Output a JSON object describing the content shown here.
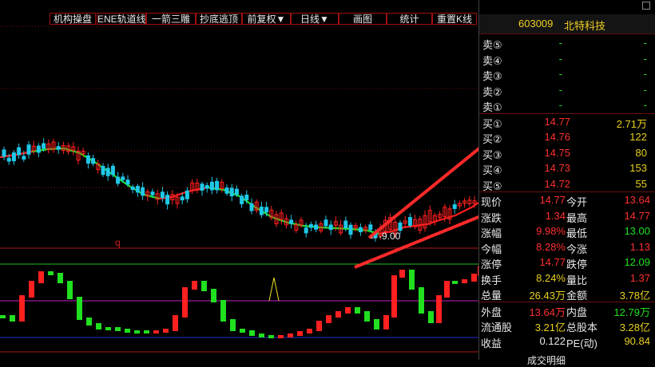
{
  "toolbar": {
    "buttons": [
      "机构操盘",
      "ENE轨道线",
      "一箭三雕",
      "抄底逃顶",
      "前复权▼",
      "日线▼",
      "画图",
      "统计",
      "重置K线"
    ]
  },
  "chart": {
    "annotation_text": "←-9.00",
    "marker_q": "q",
    "colors": {
      "up": "#ff2020",
      "down": "#20c8e8",
      "ma_green": "#20e020",
      "ma_red": "#ff2020",
      "osc_up": "#ff2020",
      "osc_down": "#20e020",
      "arrow": "#ff2a2a"
    }
  },
  "stock": {
    "code": "603009",
    "name": "北特科技"
  },
  "sell_orders": [
    {
      "label": "卖⑤",
      "price": "-",
      "volume": "-"
    },
    {
      "label": "卖④",
      "price": "-",
      "volume": "-"
    },
    {
      "label": "卖③",
      "price": "-",
      "volume": "-"
    },
    {
      "label": "卖②",
      "price": "-",
      "volume": "-"
    },
    {
      "label": "卖①",
      "price": "-",
      "volume": "-"
    }
  ],
  "buy_orders": [
    {
      "label": "买①",
      "price": "14.77",
      "volume": "2.71万"
    },
    {
      "label": "买②",
      "price": "14.76",
      "volume": "122"
    },
    {
      "label": "买③",
      "price": "14.75",
      "volume": "80"
    },
    {
      "label": "买④",
      "price": "14.73",
      "volume": "153"
    },
    {
      "label": "买⑤",
      "price": "14.72",
      "volume": "55"
    }
  ],
  "quote": [
    {
      "l1": "现价",
      "v1": "14.77",
      "c1": "red",
      "l2": "今开",
      "v2": "13.64",
      "c2": "red"
    },
    {
      "l1": "涨跌",
      "v1": "1.34",
      "c1": "red",
      "l2": "最高",
      "v2": "14.77",
      "c2": "red"
    },
    {
      "l1": "涨幅",
      "v1": "9.98%",
      "c1": "red",
      "l2": "最低",
      "v2": "13.00",
      "c2": "grn"
    },
    {
      "l1": "今幅",
      "v1": "8.28%",
      "c1": "red",
      "l2": "今涨",
      "v2": "1.13",
      "c2": "red"
    },
    {
      "l1": "涨停",
      "v1": "14.77",
      "c1": "red",
      "l2": "跌停",
      "v2": "12.09",
      "c2": "grn"
    },
    {
      "l1": "换手",
      "v1": "8.24%",
      "c1": "yel",
      "l2": "量比",
      "v2": "1.37",
      "c2": "red"
    },
    {
      "l1": "总量",
      "v1": "26.43万",
      "c1": "yel",
      "l2": "金额",
      "v2": "3.78亿",
      "c2": "yel"
    }
  ],
  "quote2": [
    {
      "l1": "外盘",
      "v1": "13.64万",
      "c1": "red",
      "l2": "内盘",
      "v2": "12.79万",
      "c2": "grn"
    },
    {
      "l1": "流通股",
      "v1": "3.21亿",
      "c1": "yel",
      "l2": "总股本",
      "v2": "3.28亿",
      "c2": "yel"
    },
    {
      "l1": "收益",
      "v1": "0.122",
      "c1": "wht",
      "l2": "PE(动)",
      "v2": "90.84",
      "c2": "yel"
    }
  ],
  "footer_label": "成交明细"
}
